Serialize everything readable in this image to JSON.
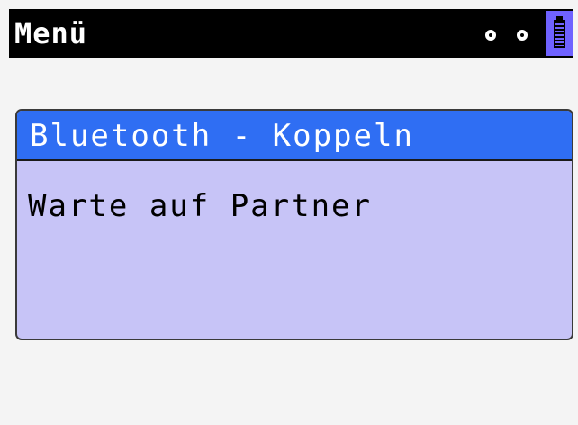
{
  "header": {
    "title": "Menü",
    "indicators": [
      "o",
      "o"
    ],
    "battery_icon": "battery-icon",
    "battery_bg_color": "#6f62ff"
  },
  "dialog": {
    "title": "Bluetooth - Koppeln",
    "message": "Warte auf Partner",
    "title_bg_color": "#2f6ef3",
    "body_bg_color": "#c7c4f7"
  }
}
